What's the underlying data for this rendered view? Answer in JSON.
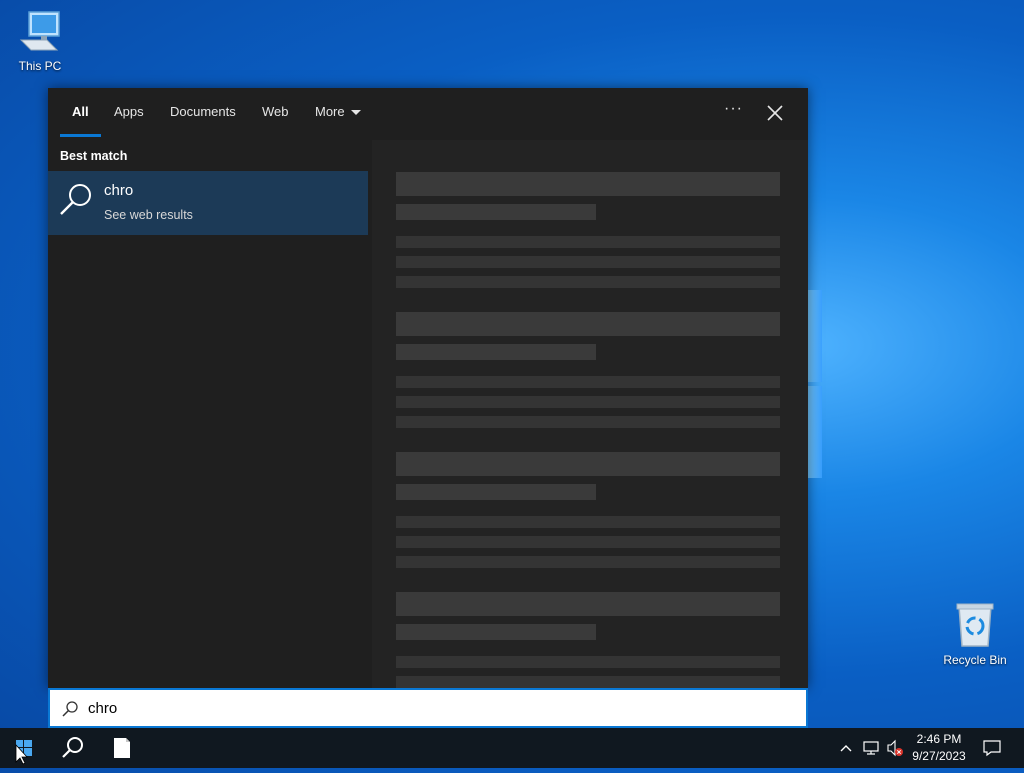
{
  "desktop": {
    "icons": [
      {
        "label": "This PC",
        "icon": "computer-icon"
      },
      {
        "label": "Recycle Bin",
        "icon": "recycle-bin-icon"
      }
    ]
  },
  "search_panel": {
    "tabs": [
      {
        "label": "All",
        "active": true
      },
      {
        "label": "Apps"
      },
      {
        "label": "Documents"
      },
      {
        "label": "Web"
      },
      {
        "label": "More"
      }
    ],
    "options_icon": "ellipsis-icon",
    "close_icon": "close-icon",
    "best_match_heading": "Best match",
    "best_match": {
      "title": "chro",
      "subtitle": "See web results",
      "icon": "search-icon"
    },
    "preview_state": "loading"
  },
  "search_box": {
    "value": "chro",
    "icon": "search-icon"
  },
  "taskbar": {
    "start_icon": "windows-start-icon",
    "search_icon": "search-icon",
    "file_icon": "file-icon",
    "tray": {
      "chevron_icon": "chevron-up-icon",
      "network_icon": "network-icon",
      "volume_icon": "volume-muted-icon",
      "time": "2:46 PM",
      "date": "9/27/2023",
      "notification_icon": "notification-icon"
    }
  },
  "colors": {
    "accent": "#0a78d4",
    "panel_bg": "#1f1f1f",
    "selected_result_bg": "#1c3a57",
    "taskbar_bg": "#101820"
  }
}
